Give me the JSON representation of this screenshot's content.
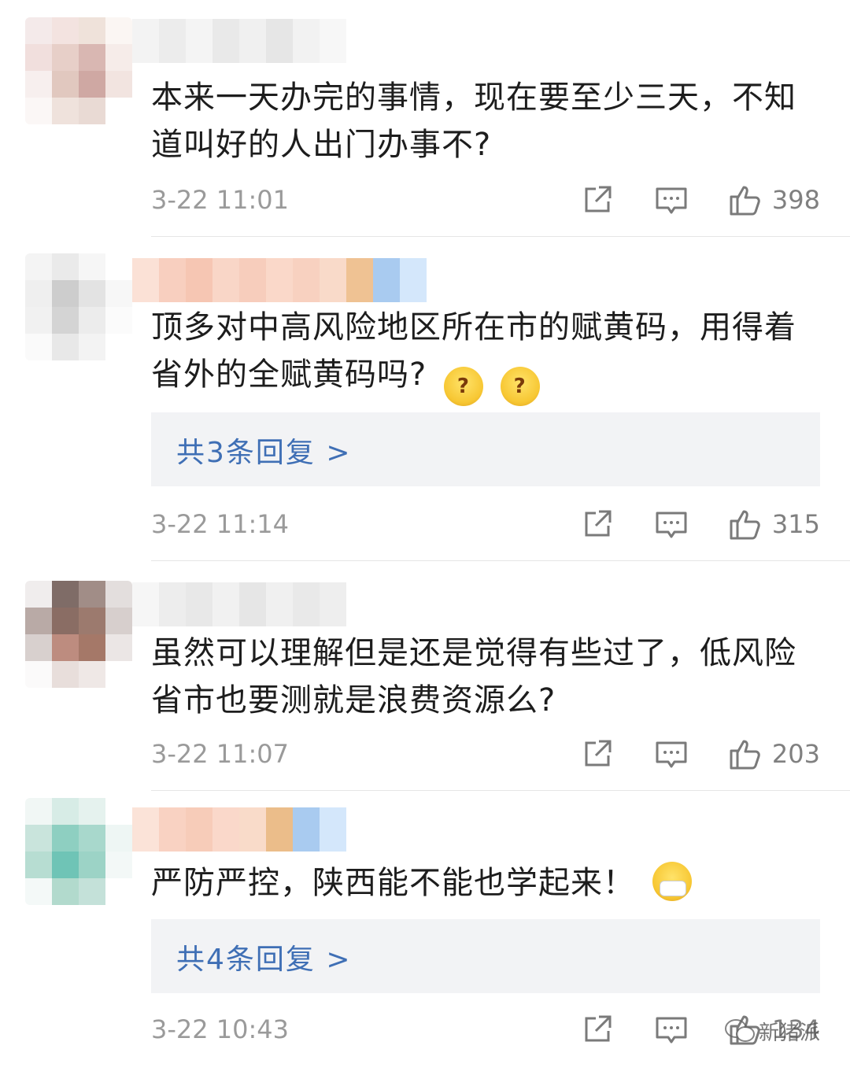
{
  "comments": [
    {
      "text": "本来一天办完的事情，现在要至少三天，不知道叫好的人出门办事不?",
      "time": "3-22 11:01",
      "likes": "398",
      "emojis": []
    },
    {
      "text": "顶多对中高风险地区所在市的赋黄码，用得着省外的全赋黄码吗?",
      "time": "3-22 11:14",
      "likes": "315",
      "emojis": [
        "confused-face",
        "confused-face"
      ],
      "reply_summary": "共3条回复 >"
    },
    {
      "text": "虽然可以理解但是还是觉得有些过了，低风险省市也要测就是浪费资源么?",
      "time": "3-22 11:07",
      "likes": "203",
      "emojis": []
    },
    {
      "text": "严防严控，陕西能不能也学起来！",
      "time": "3-22 10:43",
      "likes": "134",
      "emojis": [
        "mask-face"
      ],
      "reply_summary": "共4条回复 >"
    }
  ],
  "icons": {
    "share": "share-icon",
    "comment": "comment-icon",
    "like": "thumbs-up-icon"
  },
  "watermark": "新猪派",
  "colors": {
    "link": "#3f6fb5",
    "meta": "#9a9a9a",
    "reply_bg": "#f2f3f5"
  }
}
